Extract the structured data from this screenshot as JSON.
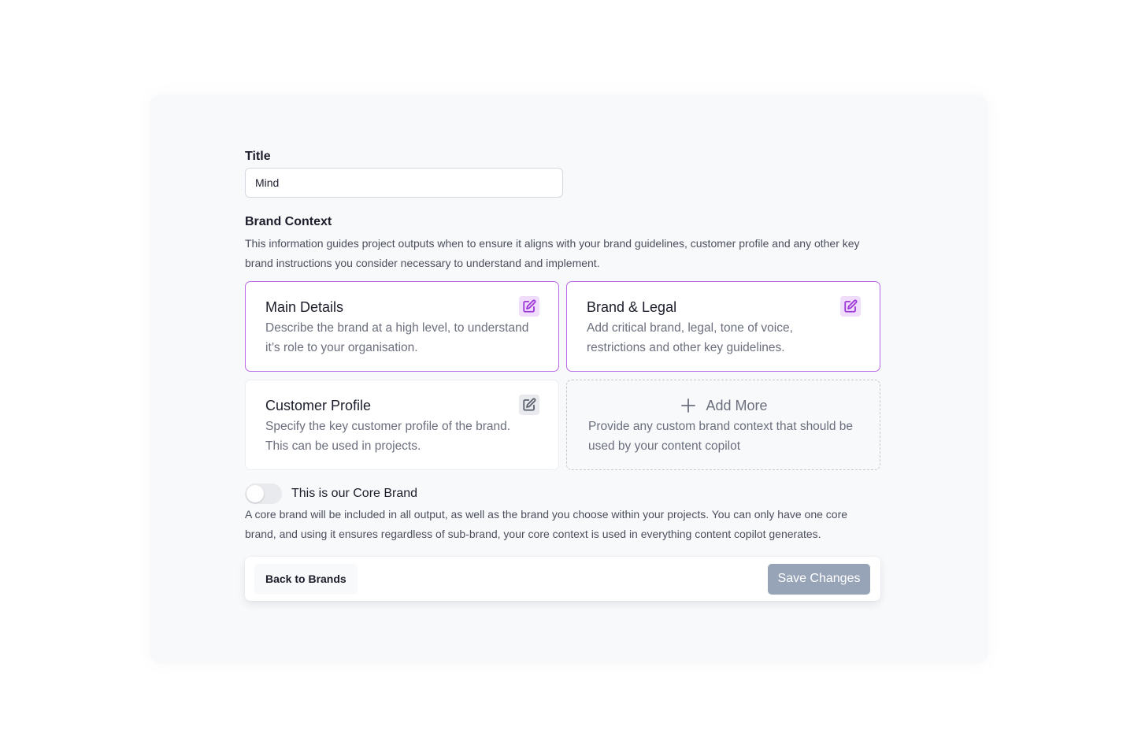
{
  "form": {
    "title_label": "Title",
    "title_value": "Mind"
  },
  "brand_context": {
    "heading": "Brand Context",
    "description": "This information guides project outputs when to ensure it aligns with your brand guidelines, customer profile and any other key brand instructions you consider necessary to understand and implement.",
    "cards": [
      {
        "title": "Main Details",
        "description": "Describe the brand at a high level, to understand it’s role to your organisation.",
        "icon": "edit-icon",
        "state": "active"
      },
      {
        "title": "Brand & Legal",
        "description": "Add critical brand, legal, tone of voice, restrictions and other key guidelines.",
        "icon": "edit-icon",
        "state": "active"
      },
      {
        "title": "Customer Profile",
        "description": "Specify the key customer profile of the brand. This can be used in projects.",
        "icon": "edit-icon",
        "state": "default"
      }
    ],
    "add_more": {
      "label": "Add More",
      "icon": "plus-icon",
      "description": "Provide any custom brand context that should be used by your content copilot"
    }
  },
  "core_brand": {
    "toggle_on": false,
    "label": "This is our Core Brand",
    "description": "A core brand will be included in all output, as well as the brand you choose within your projects. You can only have one core brand, and using it ensures regardless of sub-brand, your core context is used in everything content copilot generates."
  },
  "footer": {
    "back_label": "Back to Brands",
    "save_label": "Save Changes"
  },
  "colors": {
    "accent": "#b86ae8",
    "save_button": "#97a3b6",
    "panel_bg": "#f8f9fb"
  }
}
